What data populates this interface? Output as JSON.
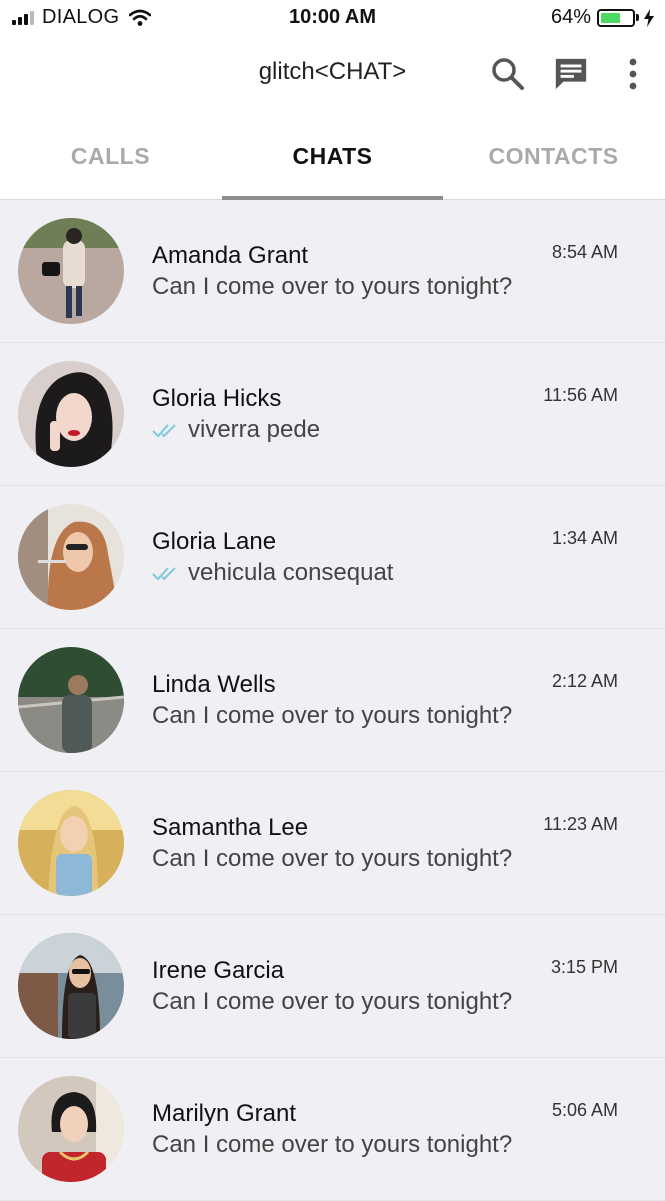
{
  "status_bar": {
    "carrier": "DIALOG",
    "time": "10:00 AM",
    "battery_percent": "64%",
    "battery_level": 0.64
  },
  "header": {
    "title": "glitch<CHAT>",
    "icons": [
      "search-icon",
      "new-message-icon",
      "more-vert-icon"
    ]
  },
  "tabs": [
    {
      "label": "CALLS",
      "active": false
    },
    {
      "label": "CHATS",
      "active": true
    },
    {
      "label": "CONTACTS",
      "active": false
    }
  ],
  "colors": {
    "accent_tick": "#7fc9e0",
    "battery_green": "#4cd964",
    "tab_indicator": "#8e8e8e"
  },
  "chats": [
    {
      "name": "Amanda Grant",
      "time": "8:54 AM",
      "preview": "Can I come over to yours tonight?",
      "read_ticks": false
    },
    {
      "name": "Gloria Hicks",
      "time": "11:56 AM",
      "preview": "viverra pede",
      "read_ticks": true
    },
    {
      "name": "Gloria Lane",
      "time": "1:34 AM",
      "preview": "vehicula consequat",
      "read_ticks": true
    },
    {
      "name": "Linda Wells",
      "time": "2:12 AM",
      "preview": "Can I come over to yours tonight?",
      "read_ticks": false
    },
    {
      "name": "Samantha Lee",
      "time": "11:23 AM",
      "preview": "Can I come over to yours tonight?",
      "read_ticks": false
    },
    {
      "name": "Irene Garcia",
      "time": "3:15 PM",
      "preview": "Can I come over to yours tonight?",
      "read_ticks": false
    },
    {
      "name": "Marilyn Grant",
      "time": "5:06 AM",
      "preview": "Can I come over to yours tonight?",
      "read_ticks": false
    }
  ]
}
